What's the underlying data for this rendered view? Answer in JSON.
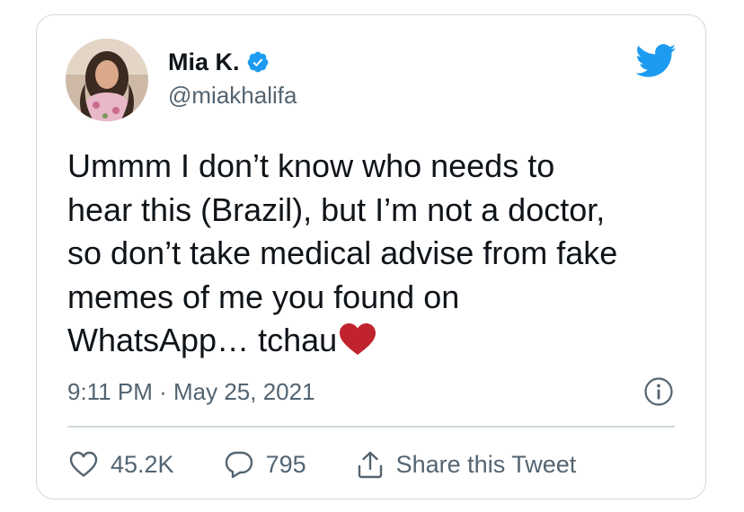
{
  "user": {
    "display_name": "Mia K.",
    "handle": "@miakhalifa",
    "verified": true,
    "avatar_icon": "profile-photo"
  },
  "tweet": {
    "text": "Ummm I don’t know who needs to\nhear this (Brazil), but I’m not a doctor,\nso don’t take medical advise from fake\nmemes of me you found on\nWhatsApp… tchau",
    "emoji": "red-heart",
    "timestamp": "9:11 PM · May 25, 2021"
  },
  "actions": {
    "likes": "45.2K",
    "replies": "795",
    "share_label": "Share this Tweet"
  },
  "colors": {
    "twitter_blue": "#1d9bf0",
    "heart_red": "#c0232c",
    "secondary_text": "#536471",
    "border": "#cfd9de"
  },
  "icons": [
    "twitter-bird-icon",
    "verified-badge-icon",
    "info-icon",
    "like-heart-icon",
    "reply-bubble-icon",
    "share-icon"
  ]
}
